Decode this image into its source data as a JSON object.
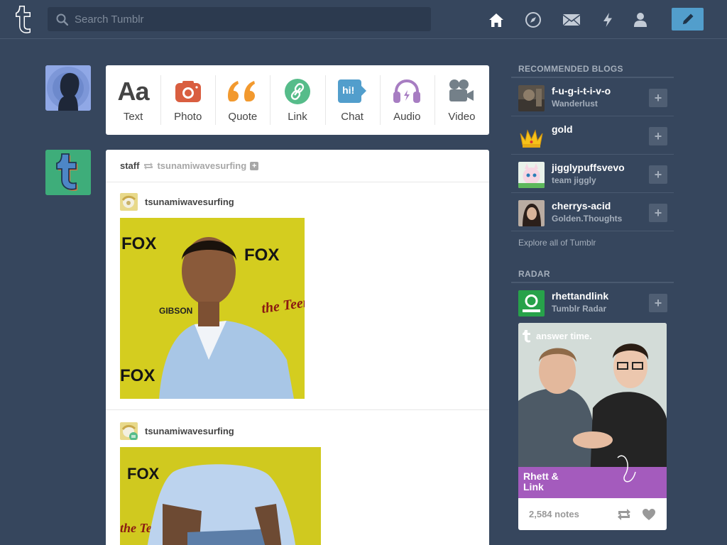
{
  "header": {
    "search_placeholder": "Search Tumblr",
    "nav_icons": [
      "home-icon",
      "explore-compass-icon",
      "mail-icon",
      "activity-lightning-icon",
      "account-icon"
    ],
    "compose_icon": "pencil-icon"
  },
  "post_types": [
    {
      "label": "Text",
      "icon": "text-icon",
      "color": "#444444"
    },
    {
      "label": "Photo",
      "icon": "camera-icon",
      "color": "#d95e40"
    },
    {
      "label": "Quote",
      "icon": "quote-icon",
      "color": "#f2992e"
    },
    {
      "label": "Link",
      "icon": "link-icon",
      "color": "#56bc8a"
    },
    {
      "label": "Chat",
      "icon": "chat-icon",
      "color": "#529ecc",
      "glyph": "hi!"
    },
    {
      "label": "Audio",
      "icon": "headphones-icon",
      "color": "#a77dc2"
    },
    {
      "label": "Video",
      "icon": "video-camera-icon",
      "color": "#748089"
    }
  ],
  "post": {
    "author": "staff",
    "reblogged_from": "tsunamiwavesurfing",
    "trail": [
      {
        "username": "tsunamiwavesurfing"
      },
      {
        "username": "tsunamiwavesurfing"
      }
    ],
    "photo_texts": {
      "fox": "FOX",
      "teen_choice": "the Teen Choice Awards",
      "gibson": "GIBSON"
    }
  },
  "sidebar": {
    "recommended_title": "RECOMMENDED BLOGS",
    "blogs": [
      {
        "name": "f-u-g-i-t-i-v-o",
        "title": "Wanderlust"
      },
      {
        "name": "gold",
        "title": ""
      },
      {
        "name": "jigglypuffsvevo",
        "title": "team jiggly"
      },
      {
        "name": "cherrys-acid",
        "title": "Golden.Thoughts"
      }
    ],
    "explore_link": "Explore all of Tumblr",
    "radar_title": "RADAR",
    "radar": {
      "name": "rhettandlink",
      "title": "Tumblr Radar",
      "image_caption": "answer time.",
      "image_title": "Rhett & Link",
      "notes": "2,584 notes"
    }
  },
  "colors": {
    "background": "#36465d",
    "accent": "#529ecc",
    "radar_banner": "#a45bbd"
  }
}
